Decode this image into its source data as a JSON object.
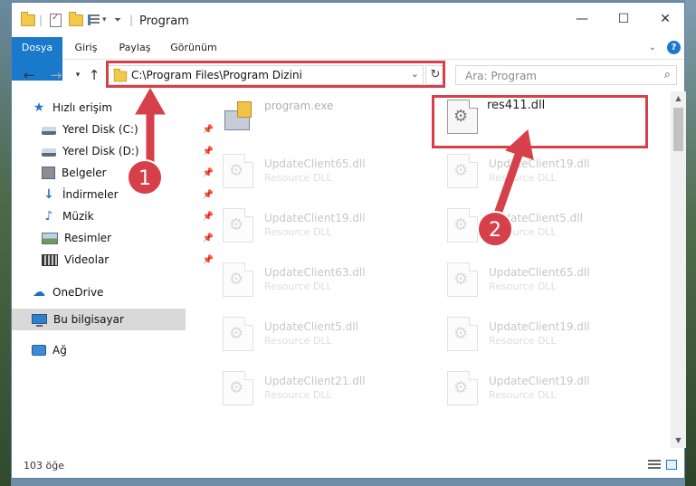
{
  "window": {
    "title": "Program"
  },
  "ribbon": {
    "tabs": [
      "Dosya",
      "Giriş",
      "Paylaş",
      "Görünüm"
    ]
  },
  "address": {
    "path": "C:\\Program Files\\Program Dizini"
  },
  "search": {
    "placeholder": "Ara: Program"
  },
  "sidebar": {
    "items": [
      {
        "label": "Hızlı erişim",
        "icon": "star-icon"
      },
      {
        "label": "Yerel Disk (C:)",
        "icon": "drive-icon",
        "pinned": true
      },
      {
        "label": "Yerel Disk (D:)",
        "icon": "drive-icon",
        "pinned": true
      },
      {
        "label": "Belgeler",
        "icon": "documents-icon",
        "pinned": true
      },
      {
        "label": "İndirmeler",
        "icon": "download-icon",
        "pinned": true
      },
      {
        "label": "Müzik",
        "icon": "music-icon",
        "pinned": true
      },
      {
        "label": "Resimler",
        "icon": "pictures-icon",
        "pinned": true
      },
      {
        "label": "Videolar",
        "icon": "video-icon",
        "pinned": true
      },
      {
        "label": "OneDrive",
        "icon": "cloud-icon"
      },
      {
        "label": "Bu bilgisayar",
        "icon": "computer-icon",
        "selected": true
      },
      {
        "label": "Ağ",
        "icon": "network-icon"
      }
    ]
  },
  "files": [
    {
      "name": "program.exe",
      "type": "",
      "icon": "exe-icon"
    },
    {
      "name": "res411.dll",
      "type": "",
      "icon": "dll-icon",
      "highlighted": true
    },
    {
      "name": "UpdateClient65.dll",
      "type": "Resource DLL",
      "icon": "dll-icon"
    },
    {
      "name": "UpdateClient19.dll",
      "type": "Resource DLL",
      "icon": "dll-icon"
    },
    {
      "name": "UpdateClient19.dll",
      "type": "Resource DLL",
      "icon": "dll-icon"
    },
    {
      "name": "UpdateClient5.dll",
      "type": "Resource DLL",
      "icon": "dll-icon"
    },
    {
      "name": "UpdateClient63.dll",
      "type": "Resource DLL",
      "icon": "dll-icon"
    },
    {
      "name": "UpdateClient65.dll",
      "type": "Resource DLL",
      "icon": "dll-icon"
    },
    {
      "name": "UpdateClient5.dll",
      "type": "Resource DLL",
      "icon": "dll-icon"
    },
    {
      "name": "UpdateClient19.dll",
      "type": "Resource DLL",
      "icon": "dll-icon"
    },
    {
      "name": "UpdateClient21.dll",
      "type": "Resource DLL",
      "icon": "dll-icon"
    },
    {
      "name": "UpdateClient19.dll",
      "type": "Resource DLL",
      "icon": "dll-icon"
    }
  ],
  "status": {
    "item_count": "103 öğe"
  },
  "annotations": {
    "step1": "1",
    "step2": "2",
    "color": "#d6404a"
  }
}
